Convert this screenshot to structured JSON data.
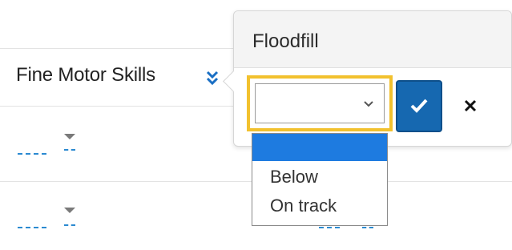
{
  "table": {
    "column_header": "Fine Motor Skills",
    "header_icon": "double-chevron-down-icon",
    "accent_color": "#2b8ad1"
  },
  "popover": {
    "title": "Floodfill",
    "select": {
      "selected_value": "",
      "options": [
        "",
        "Below",
        "On track"
      ],
      "highlight_color": "#1e7be0",
      "focus_border_color": "#f2c12e"
    },
    "confirm_icon": "check-icon",
    "cancel_icon": "close-icon",
    "confirm_color": "#1668b0"
  }
}
